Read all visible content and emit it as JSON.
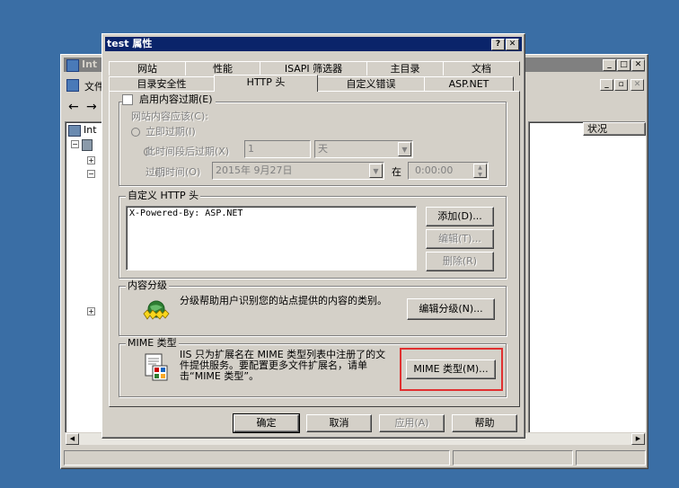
{
  "back_window": {
    "title": "Int",
    "menu_label": "文件",
    "tree_root": "Int",
    "column_header": "状况"
  },
  "dialog": {
    "title": "test 属性",
    "tabs_back": [
      "网站",
      "性能",
      "ISAPI 筛选器",
      "主目录",
      "文档"
    ],
    "tabs_front": [
      "目录安全性",
      "HTTP 头",
      "自定义错误",
      "ASP.NET"
    ],
    "active_tab": "HTTP 头",
    "expire": {
      "checkbox_label": "启用内容过期(E)",
      "heading": "网站内容应该(C):",
      "opt_immediate": "立即过期(I)",
      "opt_after": "此时间段后过期(X)",
      "after_value": "1",
      "after_unit": "天",
      "opt_on": "过期时间(O)",
      "on_date": "2015年  9月27日",
      "at_label": "在",
      "on_time": "0:00:00"
    },
    "custom_headers": {
      "legend": "自定义 HTTP 头",
      "items": [
        "X-Powered-By: ASP.NET"
      ],
      "add_label": "添加(D)...",
      "edit_label": "编辑(T)...",
      "delete_label": "删除(R)"
    },
    "rating": {
      "legend": "内容分级",
      "description": "分级帮助用户识别您的站点提供的内容的类别。",
      "button_label": "编辑分级(N)..."
    },
    "mime": {
      "legend": "MIME 类型",
      "description": "IIS 只为扩展名在 MIME 类型列表中注册了的文件提供服务。要配置更多文件扩展名，请单击“MIME 类型”。",
      "button_label": "MIME 类型(M)...",
      "highlight_color": "#e03030"
    },
    "footer": {
      "ok": "确定",
      "cancel": "取消",
      "apply": "应用(A)",
      "help": "帮助"
    }
  },
  "colors": {
    "desktop": "#3a6ea5",
    "titlebar_active": "#0a246a",
    "titlebar_inactive": "#808080",
    "face": "#d4d0c8"
  }
}
